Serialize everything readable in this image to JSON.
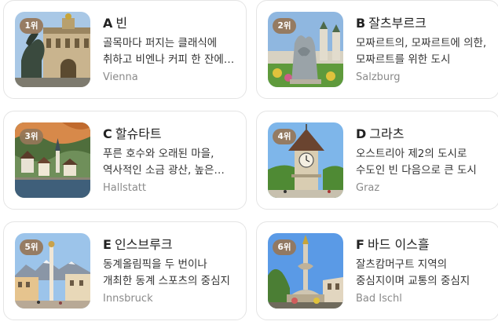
{
  "cards": [
    {
      "rank": "1위",
      "letter": "A",
      "name": "빈",
      "desc": "골목마다 퍼지는 클래식에 취하고 비엔나 커피 한 잔에 여유를 느끼는 도시",
      "en": "Vienna"
    },
    {
      "rank": "2위",
      "letter": "B",
      "name": "잘츠부르크",
      "desc": "모짜르트의, 모짜르트에 의한, 모짜르트를 위한 도시",
      "en": "Salzburg"
    },
    {
      "rank": "3위",
      "letter": "C",
      "name": "할슈타트",
      "desc": "푸른 호수와 오래된 마을, 역사적인 소금 광산, 높은 산이 어우러진 곳",
      "en": "Hallstatt"
    },
    {
      "rank": "4위",
      "letter": "D",
      "name": "그라츠",
      "desc": "오스트리아 제2의 도시로 수도인 빈 다음으로 큰 도시",
      "en": "Graz"
    },
    {
      "rank": "5위",
      "letter": "E",
      "name": "인스브루크",
      "desc": "동계올림픽을 두 번이나 개최한 동계 스포츠의 중심지",
      "en": "Innsbruck"
    },
    {
      "rank": "6위",
      "letter": "F",
      "name": "바드 이스흘",
      "desc": "잘츠캄머구트 지역의 중심지이며 교통의 중심지",
      "en": "Bad Ischl"
    }
  ]
}
